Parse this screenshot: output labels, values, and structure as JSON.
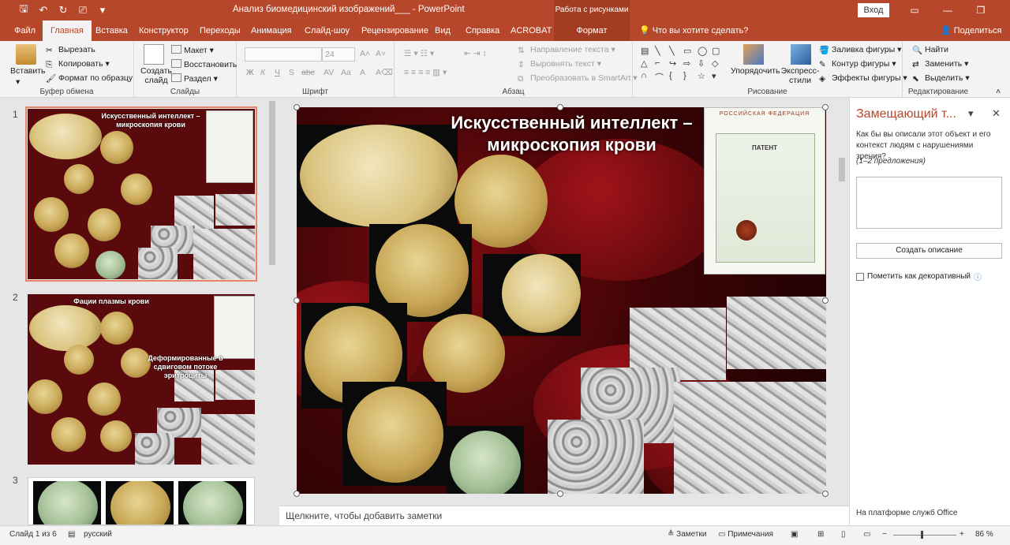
{
  "titlebar": {
    "doc_title": "Анализ биомедицинский изображений___  -  PowerPoint",
    "context_group": "Работа с рисунками",
    "login": "Вход"
  },
  "tabs": [
    "Файл",
    "Главная",
    "Вставка",
    "Конструктор",
    "Переходы",
    "Анимация",
    "Слайд-шоу",
    "Рецензирование",
    "Вид",
    "Справка",
    "ACROBAT",
    "Формат"
  ],
  "search_placeholder": "Что вы хотите сделать?",
  "share": "Поделиться",
  "ribbon": {
    "clipboard": {
      "paste": "Вставить",
      "cut": "Вырезать",
      "copy": "Копировать",
      "format_painter": "Формат по образцу",
      "label": "Буфер обмена"
    },
    "slides": {
      "new_slide": "Создать слайд",
      "layout": "Макет",
      "reset": "Восстановить",
      "section": "Раздел",
      "label": "Слайды"
    },
    "font": {
      "size": "24",
      "bold": "Ж",
      "italic": "К",
      "underline": "Ч",
      "strike": "S",
      "shadow": "abc",
      "label": "Шрифт"
    },
    "paragraph": {
      "text_direction": "Направление текста",
      "align_text": "Выровнять текст",
      "smartart": "Преобразовать в SmartArt",
      "label": "Абзац"
    },
    "drawing": {
      "arrange": "Упорядочить",
      "quick_styles": "Экспресс-стили",
      "fill": "Заливка фигуры",
      "outline": "Контур фигуры",
      "effects": "Эффекты фигуры",
      "label": "Рисование"
    },
    "editing": {
      "find": "Найти",
      "replace": "Заменить",
      "select": "Выделить",
      "label": "Редактирование"
    }
  },
  "thumbnails": [
    {
      "num": "1",
      "title": "Искусственный интеллект – микроскопия крови"
    },
    {
      "num": "2",
      "title": "Фации плазмы крови",
      "title2": "Деформированные в сдвиговом потоке эритроциты"
    },
    {
      "num": "3"
    }
  ],
  "slide": {
    "title": "Искусственный интеллект – микроскопия крови",
    "patent_header": "РОССИЙСКАЯ ФЕДЕРАЦИЯ",
    "patent_word": "ПАТЕНТ"
  },
  "notes_placeholder": "Щелкните, чтобы добавить заметки",
  "alt_text_pane": {
    "title": "Замещающий т...",
    "description": "Как бы вы описали этот объект и его контекст людям с нарушениями зрения?",
    "hint": "(1–2 предложения)",
    "generate_button": "Создать описание",
    "decorative_checkbox": "Пометить как декоративный",
    "footer": "На платформе служб Office"
  },
  "status": {
    "slide_counter": "Слайд 1 из 6",
    "language": "русский",
    "notes": "Заметки",
    "comments": "Примечания",
    "zoom": "86 %"
  },
  "colors": {
    "accent": "#b7472a",
    "context_tab": "#a33d22"
  }
}
